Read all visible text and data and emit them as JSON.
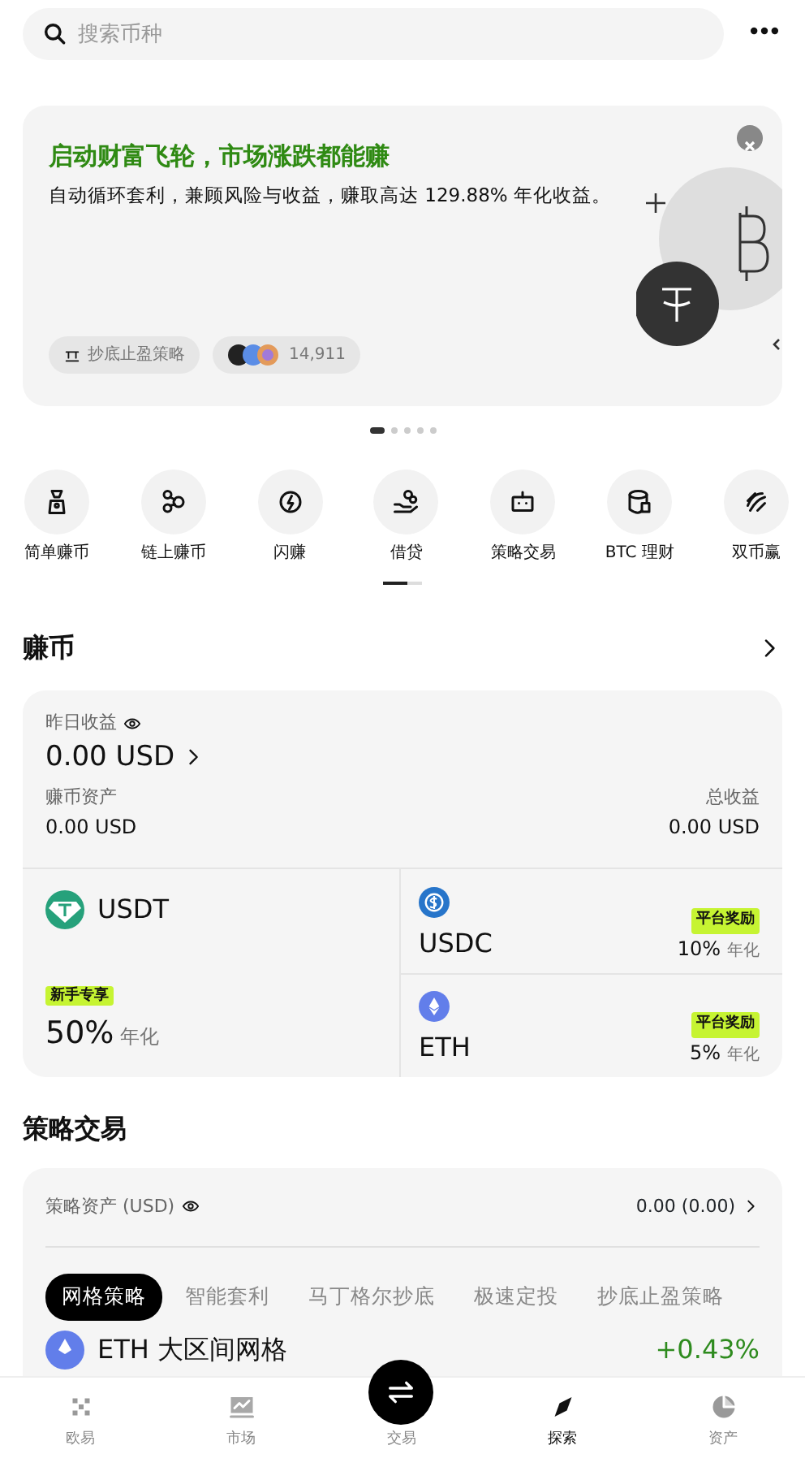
{
  "search": {
    "placeholder": "搜索币种"
  },
  "banner": {
    "title": "启动财富飞轮，市场涨跌都能赚",
    "subtitle": "自动循环套利，兼顾风险与收益，赚取高达 129.88% 年化收益。",
    "chips": [
      {
        "kind": "tag",
        "label": "抄底止盈策略"
      },
      {
        "kind": "users",
        "label": "14,911"
      }
    ]
  },
  "carousel_pages": [
    {
      "selected": true
    },
    {
      "selected": false
    },
    {
      "selected": false
    },
    {
      "selected": false
    },
    {
      "selected": false
    }
  ],
  "shortcuts": [
    {
      "kind": "bag",
      "label": "简单赚币"
    },
    {
      "kind": "nodes",
      "label": "链上赚币"
    },
    {
      "kind": "flash",
      "label": "闪赚"
    },
    {
      "kind": "loan",
      "label": "借贷"
    },
    {
      "kind": "robot",
      "label": "策略交易"
    },
    {
      "kind": "db",
      "label": "BTC 理财"
    },
    {
      "kind": "dual",
      "label": "双币赢"
    }
  ],
  "earn": {
    "title": "赚币",
    "yesterday_label": "昨日收益",
    "yesterday_value": "0.00 USD",
    "assets_label": "赚币资产",
    "assets_value": "0.00 USD",
    "total_label": "总收益",
    "total_value": "0.00 USD",
    "featured": {
      "kind": "usdt",
      "coin": "USDT",
      "badge": "新手专享",
      "rate": "50%",
      "rate_unit": "年化"
    },
    "coins": [
      {
        "kind": "usdc",
        "coin": "USDC",
        "badge": "平台奖励",
        "rate": "10%",
        "rate_unit": "年化"
      },
      {
        "kind": "eth",
        "coin": "ETH",
        "badge": "平台奖励",
        "rate": "5%",
        "rate_unit": "年化"
      }
    ]
  },
  "strategy": {
    "title": "策略交易",
    "assets_label": "策略资产 (USD)",
    "assets_value": "0.00 (0.00)",
    "tabs": [
      {
        "label": "网格策略",
        "selected": true
      },
      {
        "label": "智能套利",
        "selected": false
      },
      {
        "label": "马丁格尔抄底",
        "selected": false
      },
      {
        "label": "极速定投",
        "selected": false
      },
      {
        "label": "抄底止盈策略",
        "selected": false
      }
    ],
    "rows": [
      {
        "name": "ETH 大区间网格",
        "change": "+0.43%"
      }
    ]
  },
  "bottom_nav": [
    {
      "kind": "home",
      "label": "欧易",
      "selected": false
    },
    {
      "kind": "market",
      "label": "市场",
      "selected": false
    },
    {
      "kind": "trade",
      "label": "交易",
      "selected": false
    },
    {
      "kind": "explore",
      "label": "探索",
      "selected": true
    },
    {
      "kind": "assets",
      "label": "资产",
      "selected": false
    }
  ]
}
